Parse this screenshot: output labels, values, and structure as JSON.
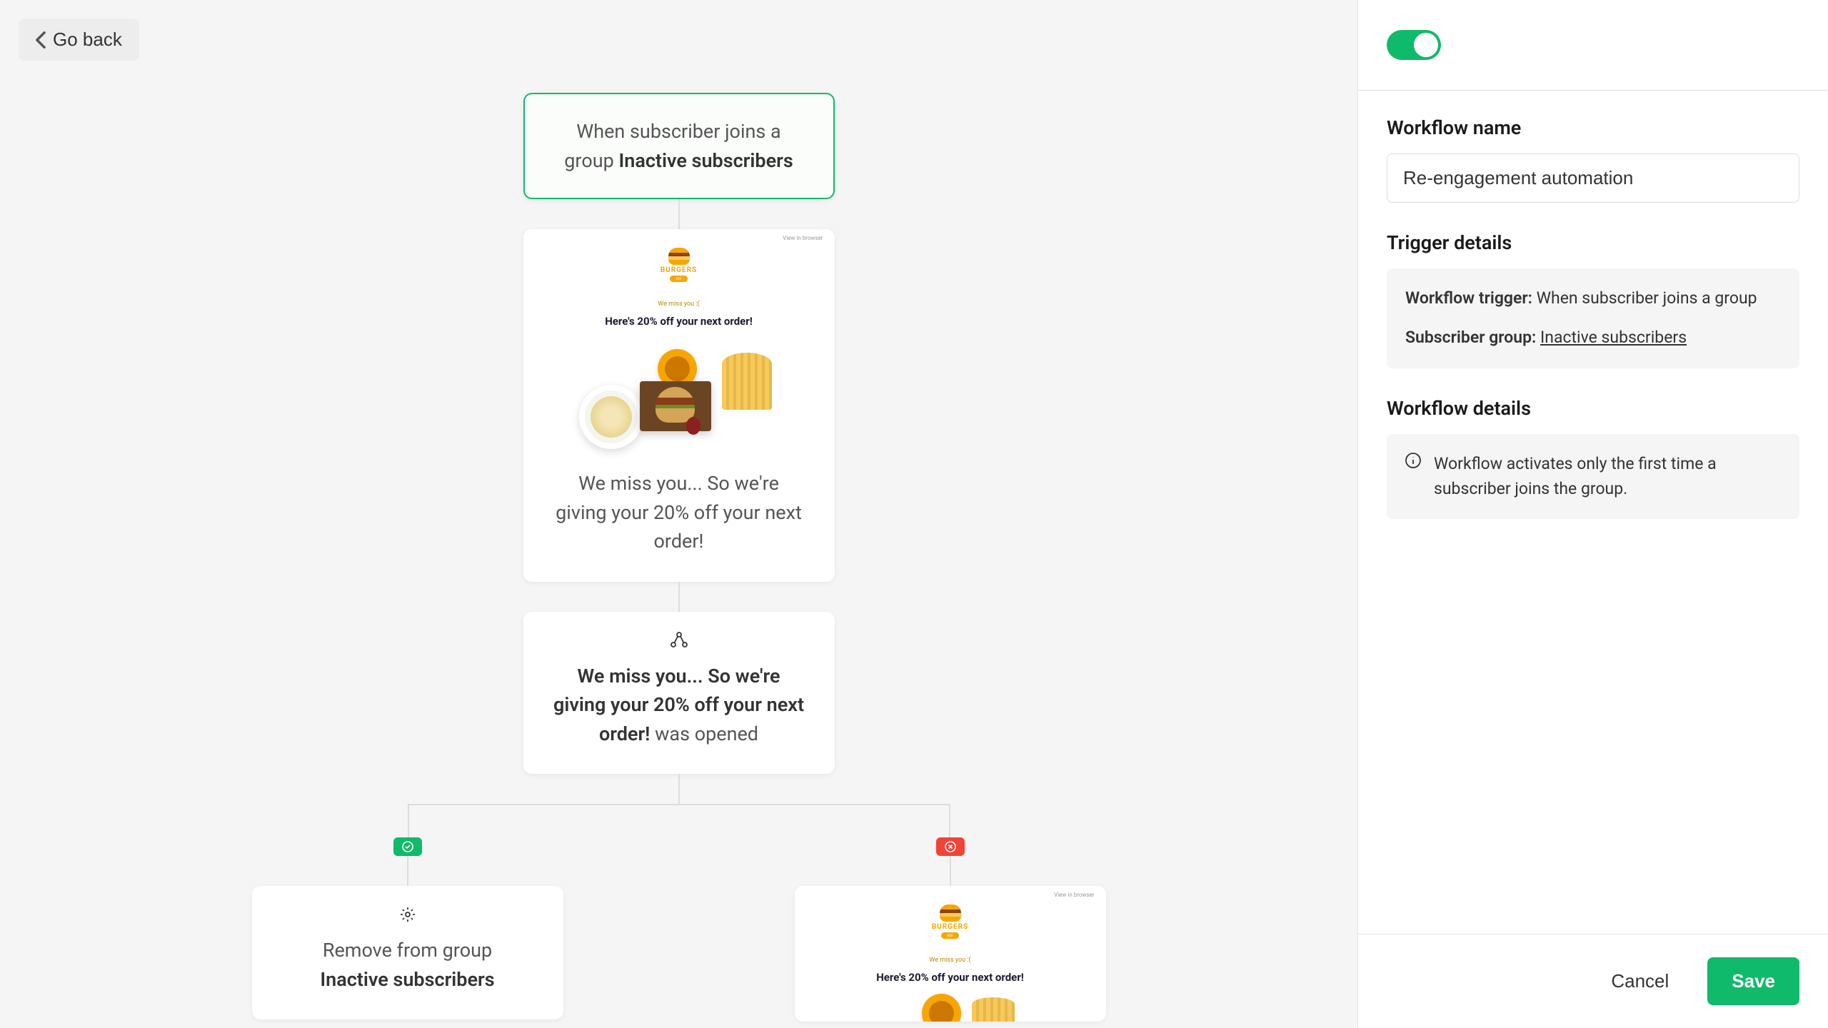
{
  "header": {
    "go_back": "Go back"
  },
  "workflow": {
    "trigger": {
      "prefix": "When subscriber joins a group ",
      "group": "Inactive subscribers"
    },
    "email1": {
      "preview_brand": "BURGERS",
      "preview_tag": "co!",
      "preview_small": "We miss you :(",
      "preview_title": "Here's 20% off your next order!",
      "caption": "We miss you... So we're giving your 20% off your next order!"
    },
    "condition": {
      "bold_part": "We miss you... So we're giving your 20% off your next order!",
      "suffix": " was opened"
    },
    "action_yes": {
      "prefix": "Remove from group",
      "group": "Inactive subscribers"
    }
  },
  "sidebar": {
    "workflow_name_label": "Workflow name",
    "workflow_name_value": "Re-engagement automation",
    "trigger_details_label": "Trigger details",
    "trigger_row1_label": "Workflow trigger:",
    "trigger_row1_value": " When subscriber joins a group",
    "trigger_row2_label": "Subscriber group:",
    "trigger_row2_value": "Inactive subscribers",
    "workflow_details_label": "Workflow details",
    "workflow_details_info": "Workflow activates only the first time a subscriber joins the group.",
    "cancel": "Cancel",
    "save": "Save"
  }
}
